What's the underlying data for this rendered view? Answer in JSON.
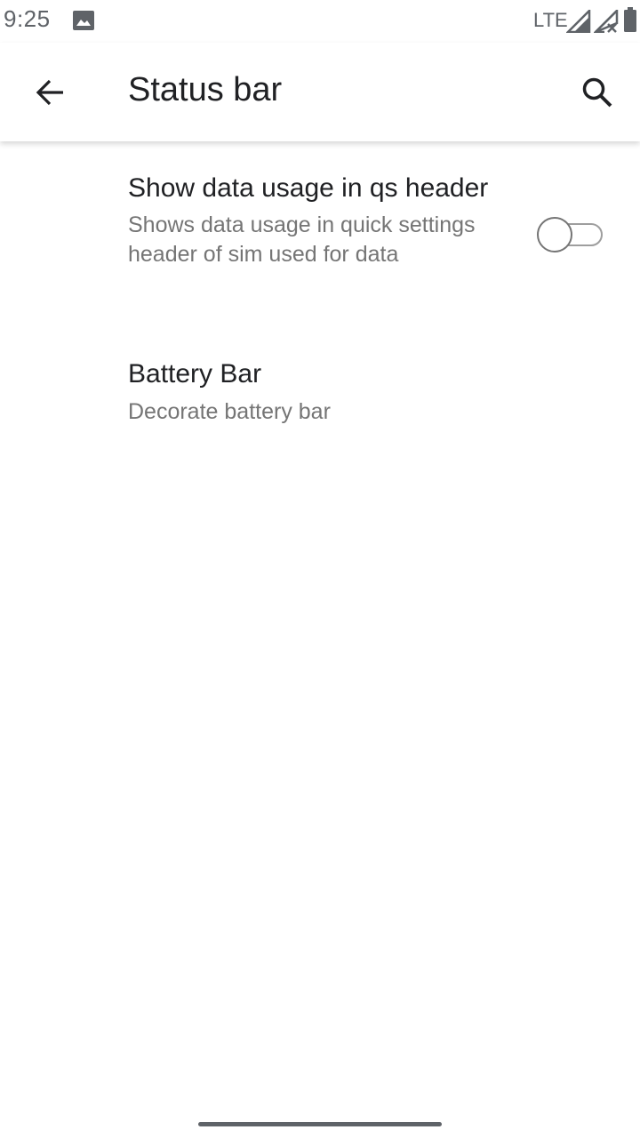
{
  "status_bar": {
    "time": "9:25",
    "network": "LTE",
    "icons": [
      "image-icon",
      "signal-icon",
      "signal-no-data-icon",
      "battery-icon"
    ]
  },
  "toolbar": {
    "title": "Status bar",
    "back_icon": "arrow-back-icon",
    "search_icon": "search-icon"
  },
  "preferences": [
    {
      "title": "Show data usage in qs header",
      "summary": "Shows data usage in quick settings header of sim used for data",
      "switch_on": false
    },
    {
      "title": "Battery Bar",
      "summary": "Decorate battery bar"
    }
  ],
  "colors": {
    "background": "#ffffff",
    "title_text": "#202124",
    "summary_text": "#757575",
    "status_icons": "#5f6368"
  }
}
